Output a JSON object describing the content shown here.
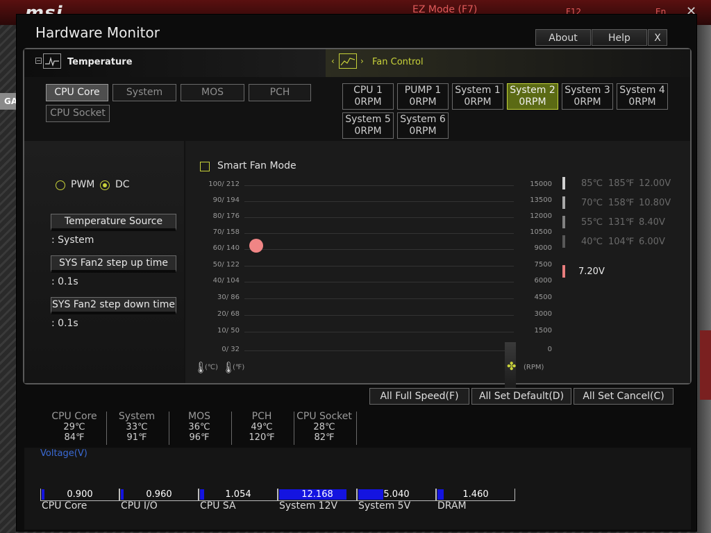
{
  "background": {
    "brand": "msi",
    "ez_mode": "EZ Mode (F7)",
    "f12": "F12",
    "lang": "En",
    "left_tab": "GA"
  },
  "window": {
    "title": "Hardware Monitor",
    "buttons": {
      "about": "About",
      "help": "Help",
      "close": "X"
    }
  },
  "temperature": {
    "title": "Temperature",
    "sources": [
      "CPU Core",
      "System",
      "MOS",
      "PCH",
      "CPU Socket"
    ],
    "active": "CPU Core"
  },
  "fan_control": {
    "title": "Fan Control",
    "fans": [
      {
        "name": "CPU 1",
        "rpm": "0RPM"
      },
      {
        "name": "PUMP 1",
        "rpm": "0RPM"
      },
      {
        "name": "System 1",
        "rpm": "0RPM"
      },
      {
        "name": "System 2",
        "rpm": "0RPM"
      },
      {
        "name": "System 3",
        "rpm": "0RPM"
      },
      {
        "name": "System 4",
        "rpm": "0RPM"
      },
      {
        "name": "System 5",
        "rpm": "0RPM"
      },
      {
        "name": "System 6",
        "rpm": "0RPM"
      }
    ],
    "active": "System 2"
  },
  "mode": {
    "pwm": "PWM",
    "dc": "DC",
    "selected": "DC"
  },
  "settings": {
    "temp_source_label": "Temperature Source",
    "temp_source_value": ": System",
    "step_up_label": "SYS Fan2 step up time",
    "step_up_value": ": 0.1s",
    "step_down_label": "SYS Fan2 step down time",
    "step_down_value": ": 0.1s"
  },
  "graph": {
    "smart_fan_label": "Smart Fan Mode",
    "left_ticks": [
      "100/ 212",
      "90/ 194",
      "80/ 176",
      "70/ 158",
      "60/ 140",
      "50/ 122",
      "40/ 104",
      "30/  86",
      "20/  68",
      "10/  50",
      "0/  32"
    ],
    "right_ticks": [
      "15000",
      "13500",
      "12000",
      "10500",
      "9000",
      "7500",
      "6000",
      "4500",
      "3000",
      "1500",
      "0"
    ],
    "unit_c": "(℃)",
    "unit_f": "(℉)",
    "unit_rpm": "(RPM)",
    "legend": [
      {
        "c": "85℃",
        "f": "185℉",
        "v": "12.00V",
        "color": "#d0d0d0"
      },
      {
        "c": "70℃",
        "f": "158℉",
        "v": "10.80V",
        "color": "#a8a8a8"
      },
      {
        "c": "55℃",
        "f": "131℉",
        "v": "8.40V",
        "color": "#808080"
      },
      {
        "c": "40℃",
        "f": "104℉",
        "v": "6.00V",
        "color": "#585858"
      }
    ],
    "current": {
      "v": "7.20V",
      "color": "#e87d7d"
    }
  },
  "actions": {
    "full_speed": "All Full Speed(F)",
    "set_default": "All Set Default(D)",
    "set_cancel": "All Set Cancel(C)"
  },
  "temps": [
    {
      "name": "CPU Core",
      "c": "29℃",
      "f": "84℉"
    },
    {
      "name": "System",
      "c": "33℃",
      "f": "91℉"
    },
    {
      "name": "MOS",
      "c": "36℃",
      "f": "96℉"
    },
    {
      "name": "PCH",
      "c": "49℃",
      "f": "120℉"
    },
    {
      "name": "CPU Socket",
      "c": "28℃",
      "f": "82℉"
    }
  ],
  "voltage": {
    "title": "Voltage(V)",
    "items": [
      {
        "name": "CPU Core",
        "value": "0.900",
        "fill": 0.04
      },
      {
        "name": "CPU I/O",
        "value": "0.960",
        "fill": 0.04
      },
      {
        "name": "CPU SA",
        "value": "1.054",
        "fill": 0.05
      },
      {
        "name": "System 12V",
        "value": "12.168",
        "fill": 0.88
      },
      {
        "name": "System 5V",
        "value": "5.040",
        "fill": 0.33
      },
      {
        "name": "DRAM",
        "value": "1.460",
        "fill": 0.08
      }
    ]
  }
}
